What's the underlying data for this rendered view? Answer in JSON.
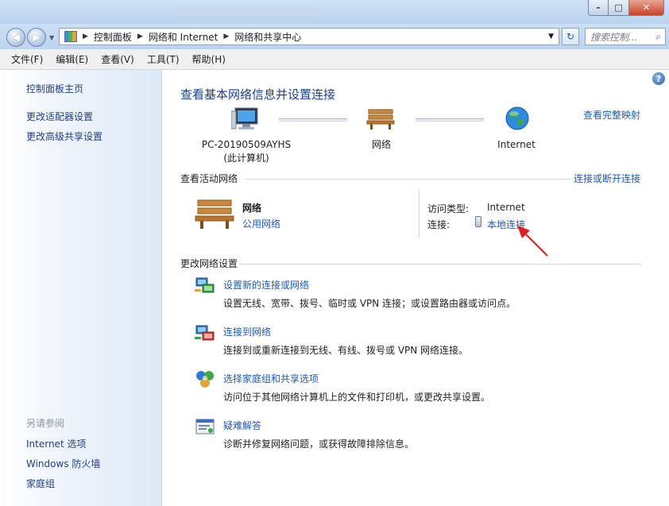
{
  "window": {
    "minimize_glyph": "–",
    "maximize_glyph": "□",
    "close_glyph": "✕"
  },
  "nav": {
    "back_glyph": "◀",
    "forward_glyph": "▶",
    "dropdown_glyph": "▼",
    "refresh_glyph": "↻",
    "search_icon": "⌕",
    "breadcrumb": [
      "控制面板",
      "网络和 Internet",
      "网络和共享中心"
    ],
    "breadcrumb_sep": "▶",
    "search_placeholder": "搜索控制..."
  },
  "menu": [
    "文件(F)",
    "编辑(E)",
    "查看(V)",
    "工具(T)",
    "帮助(H)"
  ],
  "sidebar": {
    "items": [
      "控制面板主页",
      "更改适配器设置",
      "更改高级共享设置"
    ],
    "see_also_title": "另请参阅",
    "see_also": [
      "Internet 选项",
      "Windows 防火墙",
      "家庭组"
    ]
  },
  "main": {
    "help_glyph": "?",
    "title": "查看基本网络信息并设置连接",
    "full_map_link": "查看完整映射",
    "map": {
      "computer_name": "PC-20190509AYHS",
      "computer_sub": "(此计算机)",
      "network": "网络",
      "internet": "Internet"
    },
    "active_section": {
      "title": "查看活动网络",
      "link": "连接或断开连接",
      "network_name": "网络",
      "network_type": "公用网络",
      "access_type_label": "访问类型:",
      "access_type_value": "Internet",
      "connection_label": "连接:",
      "connection_value": "本地连接"
    },
    "change_section": {
      "title": "更改网络设置",
      "tasks": [
        {
          "link": "设置新的连接或网络",
          "desc": "设置无线、宽带、拨号、临时或 VPN 连接；或设置路由器或访问点。"
        },
        {
          "link": "连接到网络",
          "desc": "连接到或重新连接到无线、有线、拨号或 VPN 网络连接。"
        },
        {
          "link": "选择家庭组和共享选项",
          "desc": "访问位于其他网络计算机上的文件和打印机，或更改共享设置。"
        },
        {
          "link": "疑难解答",
          "desc": "诊断并修复网络问题，或获得故障排除信息。"
        }
      ]
    }
  },
  "colors": {
    "link": "#1a5bb5",
    "title": "#1e3f88",
    "annotation_arrow": "#e02020"
  }
}
